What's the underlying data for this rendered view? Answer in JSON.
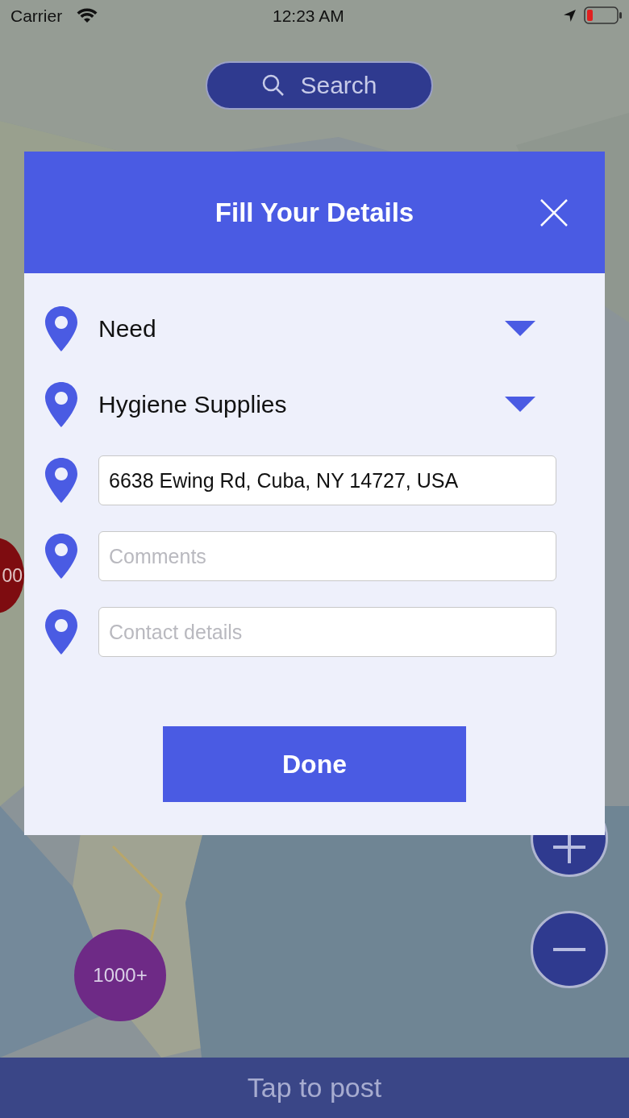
{
  "status_bar": {
    "carrier": "Carrier",
    "time": "12:23 AM"
  },
  "search": {
    "label": "Search"
  },
  "clusters": [
    {
      "label": "1000+",
      "color": "#6e2a86"
    },
    {
      "label": "00",
      "color": "#7e0c10"
    }
  ],
  "dialog": {
    "title": "Fill Your Details",
    "fields": [
      {
        "kind": "dropdown",
        "value": "Need"
      },
      {
        "kind": "dropdown",
        "value": "Hygiene Supplies"
      },
      {
        "kind": "input",
        "value": "6638 Ewing Rd, Cuba, NY 14727, USA"
      },
      {
        "kind": "input",
        "placeholder": "Comments"
      },
      {
        "kind": "input",
        "placeholder": "Contact details"
      }
    ],
    "done": "Done"
  },
  "bottom_bar": {
    "label": "Tap to post"
  }
}
